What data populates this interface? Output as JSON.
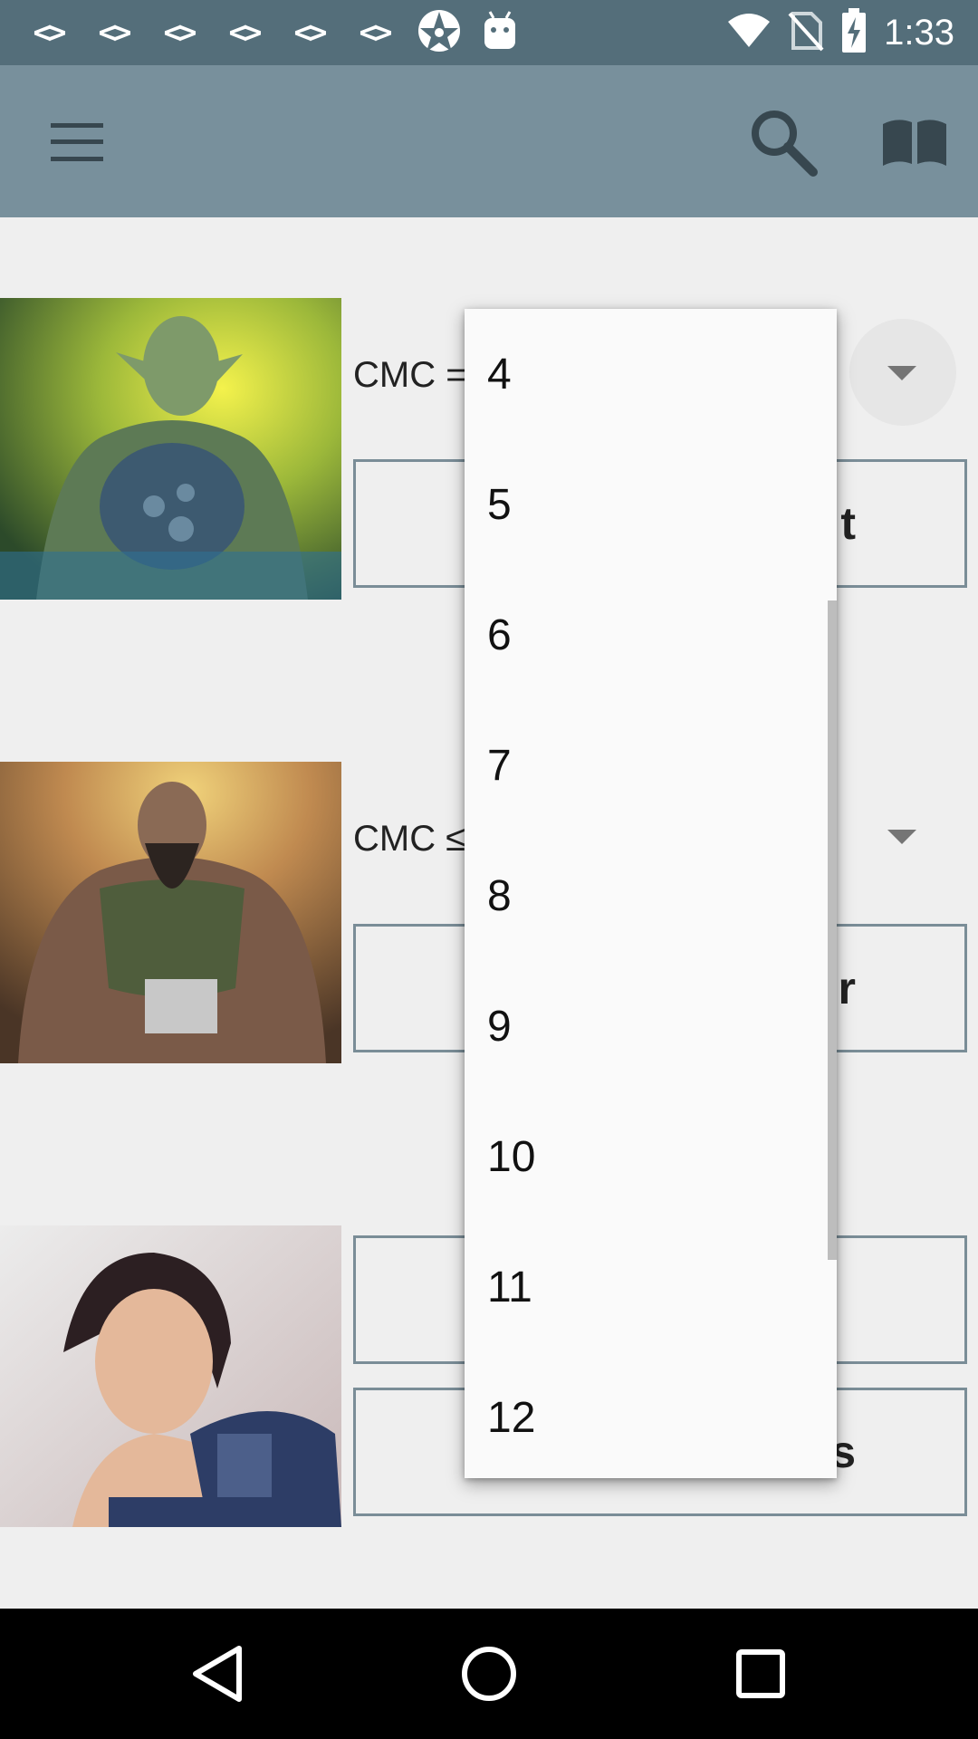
{
  "status_bar": {
    "time": "1:33",
    "left_icons": [
      "<>",
      "<>",
      "<>",
      "<>",
      "<>",
      "<>",
      "app-icon",
      "android-icon"
    ],
    "right_icons": [
      "wifi-icon",
      "no-sim-icon",
      "battery-charging-icon"
    ]
  },
  "toolbar": {
    "icons": [
      "menu-icon",
      "search-icon",
      "book-icon"
    ],
    "color": "#78909c"
  },
  "rows": [
    {
      "label": "CMC =",
      "button_text_partial": "t"
    },
    {
      "label": "CMC ≤",
      "button_text_partial": "r"
    },
    {
      "button_text_partial": "s"
    }
  ],
  "dropdown": {
    "options": [
      "4",
      "5",
      "6",
      "7",
      "8",
      "9",
      "10",
      "11",
      "12"
    ]
  },
  "nav_bar": {
    "icons": [
      "back-icon",
      "home-icon",
      "recents-icon"
    ]
  }
}
